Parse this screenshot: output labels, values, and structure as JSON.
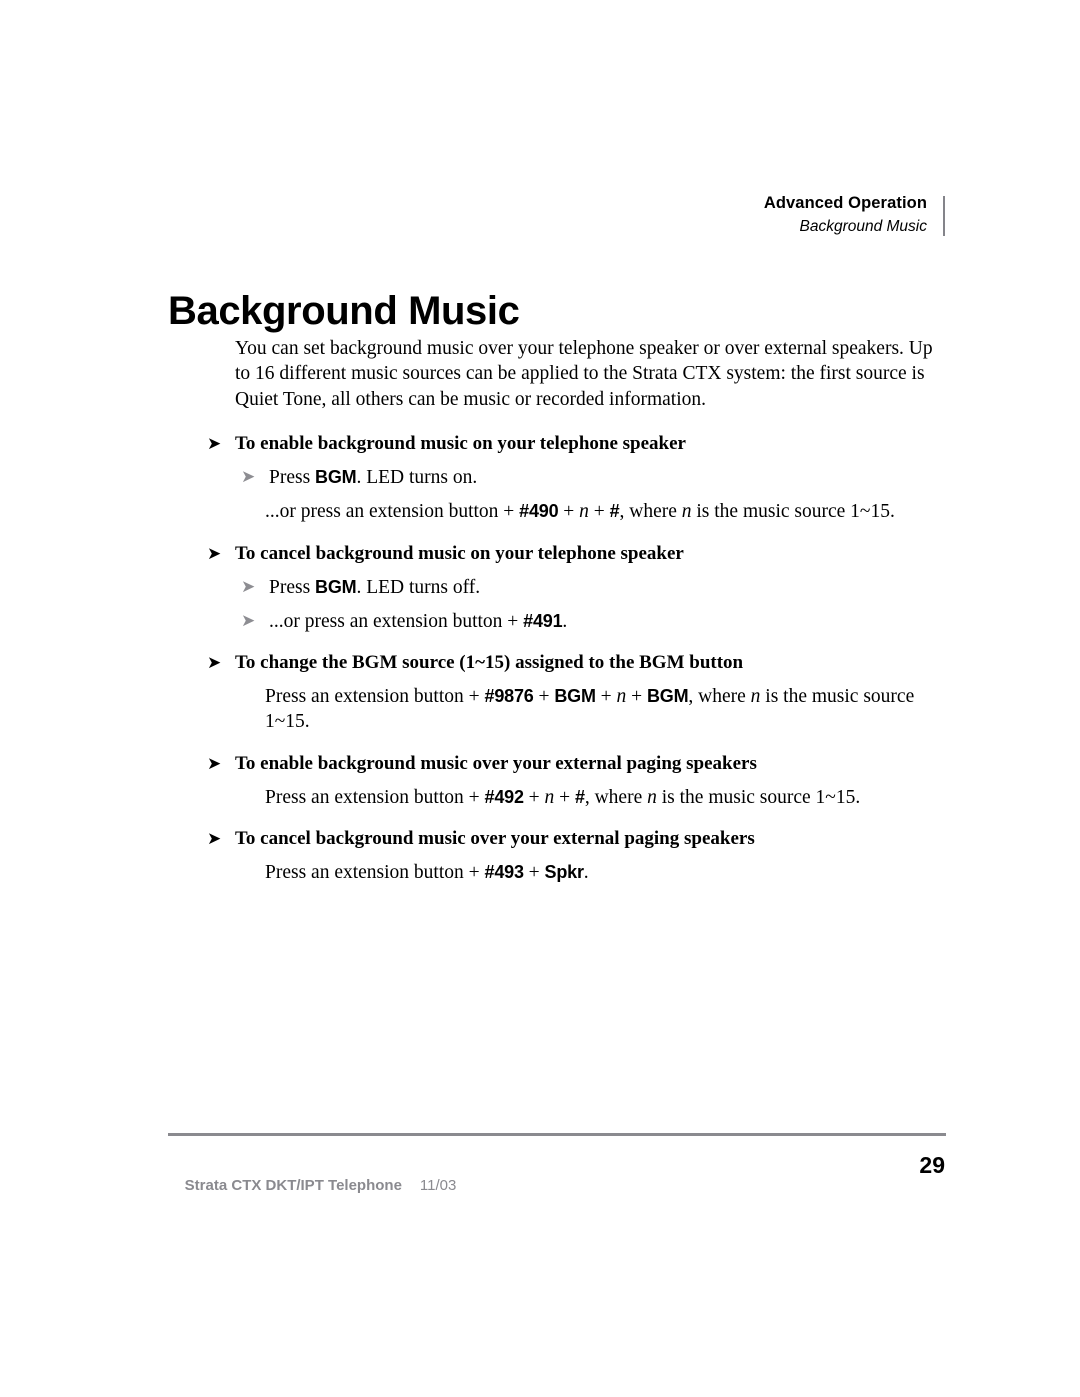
{
  "header": {
    "chapter": "Advanced Operation",
    "section": "Background Music"
  },
  "title": "Background Music",
  "intro": "You can set background music over your telephone speaker or over external speakers. Up to 16 different music sources can be applied to the Strata CTX system: the first source is Quiet Tone, all others can be music or recorded information.",
  "bullets": {
    "black_arrow": "➤",
    "gray_arrow": "➤"
  },
  "sections": [
    {
      "heading": "To enable background music on your telephone speaker",
      "items": [
        {
          "bullet": "gray",
          "parts": [
            {
              "t": "Press ",
              "s": "plain"
            },
            {
              "t": "BGM",
              "s": "key"
            },
            {
              "t": ". LED turns on.",
              "s": "plain"
            }
          ]
        },
        {
          "bullet": "none",
          "parts": [
            {
              "t": "...or press an extension button + ",
              "s": "plain"
            },
            {
              "t": "#490",
              "s": "key"
            },
            {
              "t": " + ",
              "s": "plain"
            },
            {
              "t": "n",
              "s": "var"
            },
            {
              "t": " + ",
              "s": "plain"
            },
            {
              "t": "#",
              "s": "key"
            },
            {
              "t": ", where ",
              "s": "plain"
            },
            {
              "t": "n",
              "s": "var"
            },
            {
              "t": " is the music source 1~15.",
              "s": "plain"
            }
          ]
        }
      ]
    },
    {
      "heading": "To cancel background music on your telephone speaker",
      "items": [
        {
          "bullet": "gray",
          "parts": [
            {
              "t": "Press ",
              "s": "plain"
            },
            {
              "t": "BGM",
              "s": "key"
            },
            {
              "t": ". LED turns off.",
              "s": "plain"
            }
          ]
        },
        {
          "bullet": "gray",
          "parts": [
            {
              "t": "...or press an extension button + ",
              "s": "plain"
            },
            {
              "t": "#491",
              "s": "key"
            },
            {
              "t": ".",
              "s": "plain"
            }
          ]
        }
      ]
    },
    {
      "heading": "To change the BGM source (1~15) assigned to the BGM button",
      "items": [
        {
          "bullet": "none",
          "parts": [
            {
              "t": "Press an extension button + ",
              "s": "plain"
            },
            {
              "t": "#9876",
              "s": "key"
            },
            {
              "t": " + ",
              "s": "plain"
            },
            {
              "t": "BGM",
              "s": "key"
            },
            {
              "t": " + ",
              "s": "plain"
            },
            {
              "t": "n",
              "s": "var"
            },
            {
              "t": " + ",
              "s": "plain"
            },
            {
              "t": "BGM",
              "s": "key"
            },
            {
              "t": ", where ",
              "s": "plain"
            },
            {
              "t": "n",
              "s": "var"
            },
            {
              "t": " is the music source 1~15.",
              "s": "plain"
            }
          ]
        }
      ]
    },
    {
      "heading": "To enable background music over your external paging speakers",
      "items": [
        {
          "bullet": "none",
          "parts": [
            {
              "t": "Press an extension button + ",
              "s": "plain"
            },
            {
              "t": "#492",
              "s": "key"
            },
            {
              "t": " + ",
              "s": "plain"
            },
            {
              "t": "n",
              "s": "var"
            },
            {
              "t": " + ",
              "s": "plain"
            },
            {
              "t": "#",
              "s": "key"
            },
            {
              "t": ", where ",
              "s": "plain"
            },
            {
              "t": "n",
              "s": "var"
            },
            {
              "t": " is the music source 1~15.",
              "s": "plain"
            }
          ]
        }
      ]
    },
    {
      "heading": "To cancel background music over your external paging speakers",
      "items": [
        {
          "bullet": "none",
          "parts": [
            {
              "t": "Press an extension button + ",
              "s": "plain"
            },
            {
              "t": "#493",
              "s": "key"
            },
            {
              "t": " + ",
              "s": "plain"
            },
            {
              "t": "Spkr",
              "s": "key"
            },
            {
              "t": ".",
              "s": "plain"
            }
          ]
        }
      ]
    }
  ],
  "footer": {
    "doc_name": "Strata CTX DKT/IPT Telephone",
    "doc_date": "11/03",
    "page_number": "29"
  },
  "colors": {
    "text": "#000000",
    "gray_bullet": "#8d8d92",
    "rule": "#8a8a8f",
    "footer_text": "#8a8a8f"
  }
}
